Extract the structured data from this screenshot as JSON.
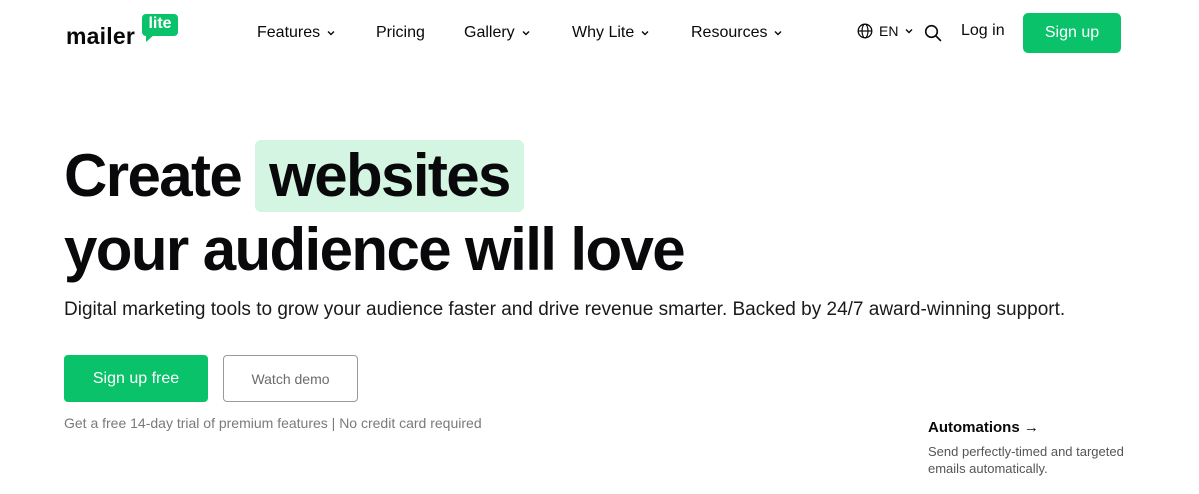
{
  "brand": {
    "word": "mailer",
    "badge": "lite",
    "accent": "#09c269",
    "highlight_bg": "#d3f5e1"
  },
  "nav": [
    {
      "label": "Features",
      "dropdown": true
    },
    {
      "label": "Pricing",
      "dropdown": false
    },
    {
      "label": "Gallery",
      "dropdown": true
    },
    {
      "label": "Why Lite",
      "dropdown": true
    },
    {
      "label": "Resources",
      "dropdown": true
    }
  ],
  "header": {
    "language": "EN",
    "language_icon": "globe-icon",
    "search_icon": "search-icon",
    "login": "Log in",
    "signup": "Sign up"
  },
  "hero": {
    "line1_prefix": "Create",
    "line1_highlight": "websites",
    "line2": "your audience will love",
    "subtitle": "Digital marketing tools to grow your audience faster and drive revenue smarter. Backed by 24/7 award-winning support.",
    "primary_cta": "Sign up free",
    "secondary_cta": "Watch demo",
    "trial_note": "Get a free 14-day trial of premium features | No credit card required"
  },
  "feature_card": {
    "title": "Automations →",
    "description": "Send perfectly-timed and targeted emails automatically."
  }
}
